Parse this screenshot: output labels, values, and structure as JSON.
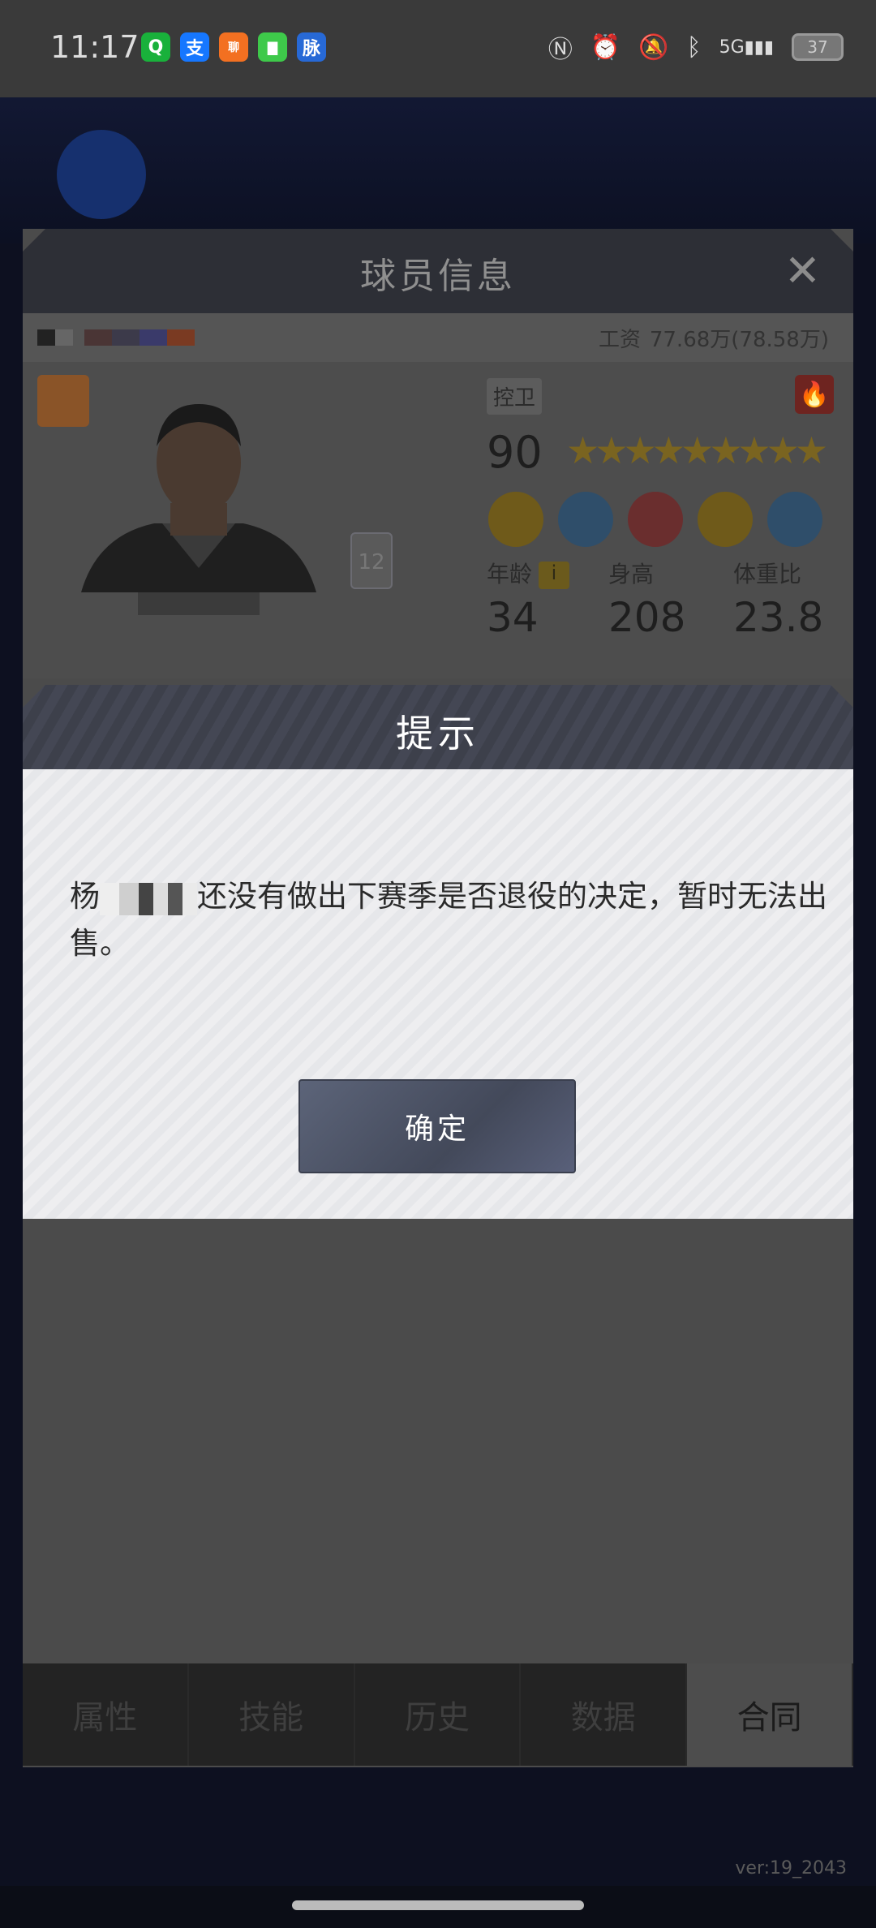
{
  "status_bar": {
    "time": "11:17",
    "apps": [
      {
        "icon": "qq-icon",
        "glyph": "Q",
        "color": "#19b13b"
      },
      {
        "icon": "alipay-icon",
        "glyph": "支",
        "color": "#1677ff"
      },
      {
        "icon": "chat-app-icon",
        "glyph": "聊",
        "color": "#f37021"
      },
      {
        "icon": "message-icon",
        "glyph": "▇",
        "color": "#3ec94a"
      },
      {
        "icon": "maimai-icon",
        "glyph": "脉",
        "color": "#2769d6"
      }
    ],
    "battery": "37"
  },
  "panel": {
    "title": "球员信息",
    "close": "✕",
    "salary_label": "工资",
    "salary_value": "77.68万(78.58万)",
    "position": "控卫",
    "rating": "90",
    "stars": "★★★★★★★★★",
    "jersey_number": "12",
    "stats": [
      {
        "label": "年龄",
        "value": "34"
      },
      {
        "label": "身高",
        "value": "208"
      },
      {
        "label": "体重比",
        "value": "23.8"
      }
    ]
  },
  "tabs": [
    "属性",
    "技能",
    "历史",
    "数据",
    "合同"
  ],
  "active_tab": "合同",
  "version": "ver:19_2043",
  "modal": {
    "title": "提示",
    "message_prefix": "杨",
    "message_rest": "还没有做出下赛季是否退役的决定，暂时无法出售。",
    "confirm": "确定"
  }
}
